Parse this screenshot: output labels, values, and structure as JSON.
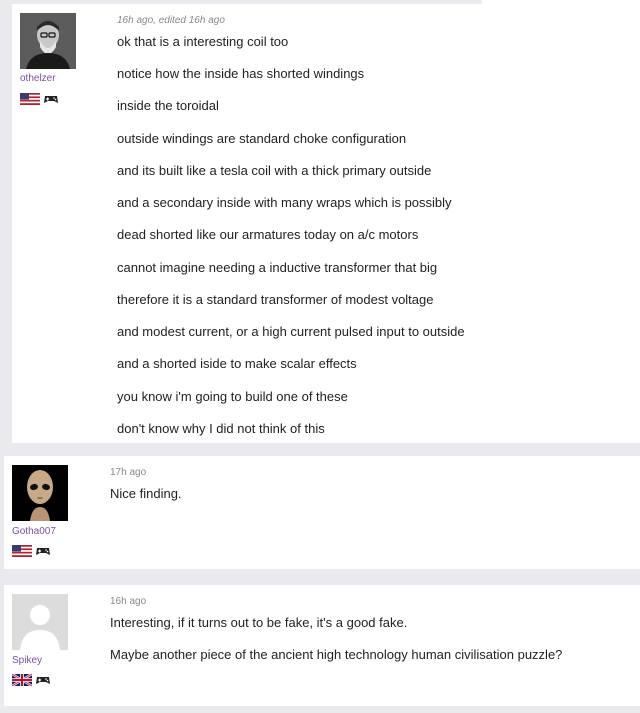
{
  "comments": [
    {
      "username": "othelzer",
      "meta": "16h ago, edited 16h ago",
      "flag": "us",
      "lines": [
        "ok that is a interesting coil too",
        "notice how the inside has shorted windings",
        "inside the toroidal",
        "outside windings are standard choke configuration",
        "and its built like a tesla coil with a thick primary outside",
        "and a secondary inside with many wraps which is possibly",
        "dead shorted like our armatures today on a/c motors",
        "cannot imagine needing a inductive transformer that big",
        "therefore it is a standard transformer of modest voltage",
        "and modest current, or a high current pulsed input to outside",
        "and a shorted iside to make scalar effects",
        "you know i'm going to build one of these",
        "don't know why I did not think of this"
      ]
    },
    {
      "username": "Gotha007",
      "meta": "17h ago",
      "flag": "us",
      "lines": [
        "Nice finding."
      ]
    },
    {
      "username": "Spikey",
      "meta": "16h ago",
      "flag": "uk",
      "lines": [
        "Interesting, if it turns out to be fake, it's a good fake.",
        "Maybe another piece of the ancient high technology human civilisation puzzle?"
      ]
    }
  ],
  "colors": {
    "username": "#7b4fa8",
    "meta": "#888888",
    "background": "#e9e9ee"
  }
}
